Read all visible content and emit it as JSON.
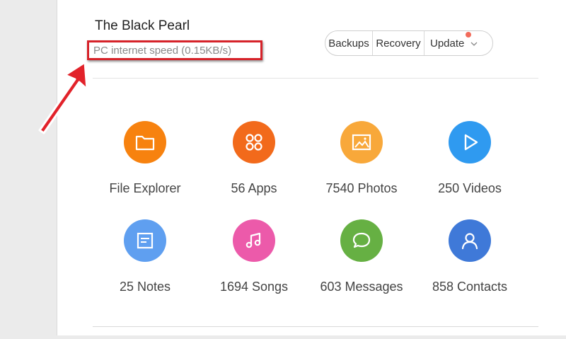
{
  "device": {
    "name": "The Black Pearl",
    "speed_text": "PC internet speed (0.15KB/s)"
  },
  "toolbar": {
    "backups_label": "Backups",
    "recovery_label": "Recovery",
    "update_label": "Update"
  },
  "tiles": [
    {
      "label": "File Explorer",
      "icon": "folder-icon",
      "color": "#f7820f"
    },
    {
      "label": "56 Apps",
      "icon": "apps-grid-icon",
      "color": "#f26a1b"
    },
    {
      "label": "7540 Photos",
      "icon": "photo-icon",
      "color": "#f8a83a"
    },
    {
      "label": "250 Videos",
      "icon": "play-icon",
      "color": "#2f9af0"
    },
    {
      "label": "25 Notes",
      "icon": "note-icon",
      "color": "#5f9ff0"
    },
    {
      "label": "1694 Songs",
      "icon": "music-note-icon",
      "color": "#ec5aaa"
    },
    {
      "label": "603 Messages",
      "icon": "chat-bubble-icon",
      "color": "#66b043"
    },
    {
      "label": "858 Contacts",
      "icon": "contact-person-icon",
      "color": "#3f79d8"
    }
  ],
  "colors": {
    "highlight_border": "#d6232a",
    "update_badge": "#f26b5b"
  }
}
